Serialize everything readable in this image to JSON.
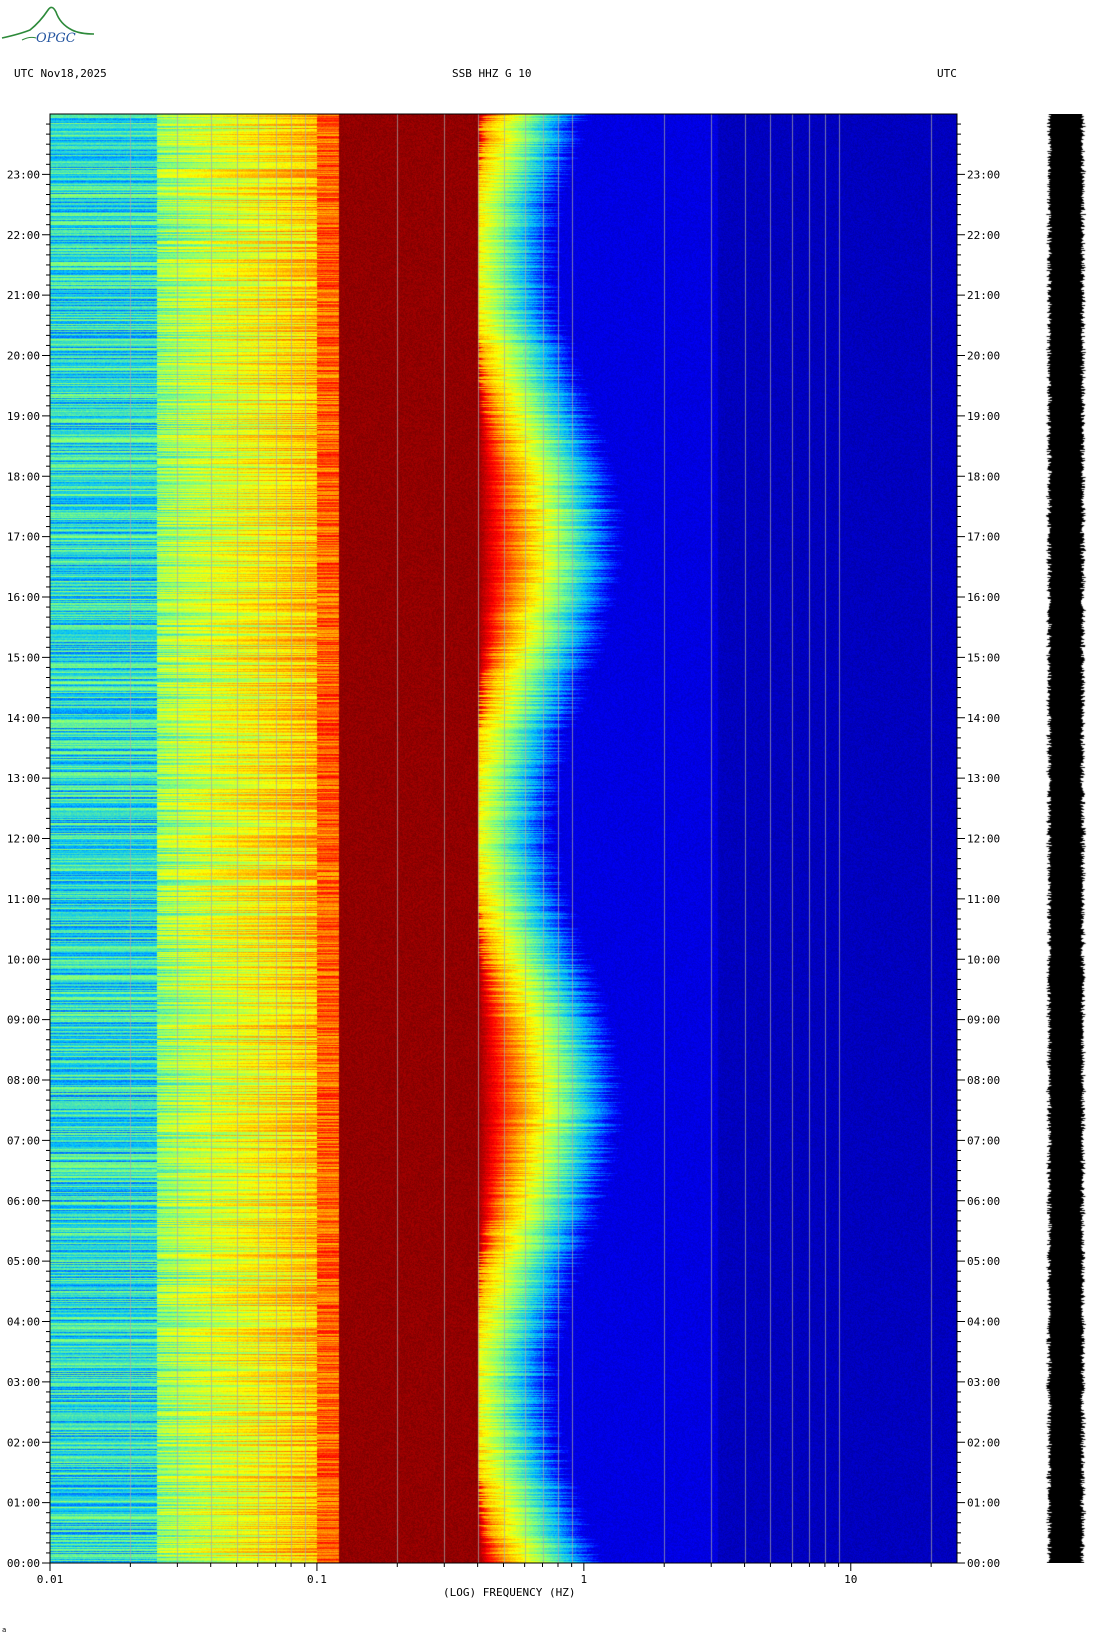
{
  "header": {
    "logo_text": "OPGC",
    "left_label": "UTC  Nov18,2025",
    "center_label": "SSB HHZ G 10",
    "right_label": "UTC"
  },
  "chart_data": {
    "type": "heatmap",
    "title": "SSB HHZ G 10",
    "date": "Nov18,2025",
    "xlabel": "(LOG) FREQUENCY (HZ)",
    "ylabel": "UTC",
    "x_scale": "log",
    "xlim": [
      0.01,
      25
    ],
    "x_ticks": [
      "0.01",
      "0.1",
      "1",
      "10"
    ],
    "y_ticks": [
      "00:00",
      "01:00",
      "02:00",
      "03:00",
      "04:00",
      "05:00",
      "06:00",
      "07:00",
      "08:00",
      "09:00",
      "10:00",
      "11:00",
      "12:00",
      "13:00",
      "14:00",
      "15:00",
      "16:00",
      "17:00",
      "18:00",
      "19:00",
      "20:00",
      "21:00",
      "22:00",
      "23:00"
    ],
    "colormap": [
      "#000080",
      "#0000ff",
      "#00bfff",
      "#7fff7f",
      "#ffff00",
      "#ff8000",
      "#ff0000",
      "#800000"
    ],
    "description_bands_hz": [
      {
        "from": 0.01,
        "to": 0.025,
        "color": "cyan-green"
      },
      {
        "from": 0.025,
        "to": 0.1,
        "color": "green-yellow-orange"
      },
      {
        "from": 0.1,
        "to": 0.4,
        "color": "dark-red"
      },
      {
        "from": 0.4,
        "to": 0.9,
        "color": "yellow-to-blue transition"
      },
      {
        "from": 0.9,
        "to": 25,
        "color": "dark-blue"
      }
    ],
    "footnote": "a"
  }
}
